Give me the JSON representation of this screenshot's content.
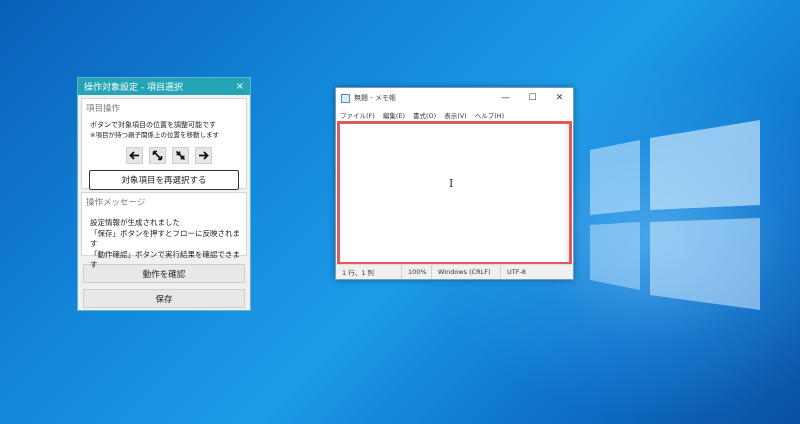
{
  "panel": {
    "title": "操作対象設定 - 項目選択",
    "close_glyph": "×",
    "ops": {
      "title": "項目操作",
      "desc_line1": "ボタンで対象項目の位置を調整可能です",
      "desc_line2": "※項目が持つ親子関係上の位置を移動します",
      "arrows": [
        "←",
        "⤡",
        "⤡",
        "→"
      ],
      "reselect_label": "対象項目を再選択する"
    },
    "message": {
      "title": "操作メッセージ",
      "lines": [
        "設定情報が生成されました",
        "「保存」ボタンを押すとフローに反映されます",
        "「動作確認」ボタンで実行結果を確認できます"
      ]
    },
    "verify_label": "動作を確認",
    "save_label": "保存"
  },
  "notepad": {
    "title": "無題 - メモ帳",
    "controls": {
      "minimize": "—",
      "maximize": "☐",
      "close": "✕"
    },
    "menu": [
      "ファイル(F)",
      "編集(E)",
      "書式(O)",
      "表示(V)",
      "ヘルプ(H)"
    ],
    "caret_glyph": "I",
    "status": {
      "position": "1 行、1 列",
      "zoom": "100%",
      "line_ending": "Windows (CRLF)",
      "encoding": "UTF-8"
    }
  },
  "colors": {
    "panel_title_bg": "#23a5b6",
    "highlight_border": "#e05a5a",
    "desktop_bg": "#1489dc"
  }
}
